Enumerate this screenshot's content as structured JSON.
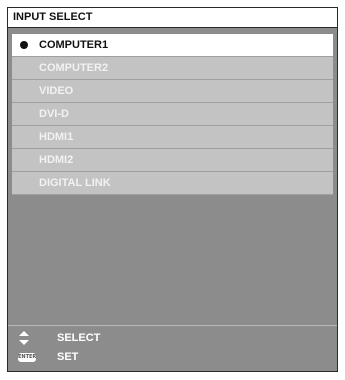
{
  "window": {
    "title": "INPUT SELECT"
  },
  "inputs": [
    {
      "label": "COMPUTER1",
      "selected": true
    },
    {
      "label": "COMPUTER2",
      "selected": false
    },
    {
      "label": "VIDEO",
      "selected": false
    },
    {
      "label": "DVI-D",
      "selected": false
    },
    {
      "label": "HDMI1",
      "selected": false
    },
    {
      "label": "HDMI2",
      "selected": false
    },
    {
      "label": "DIGITAL LINK",
      "selected": false
    }
  ],
  "footer": {
    "select": {
      "icon": "up-down-arrows-icon",
      "label": "SELECT"
    },
    "set": {
      "icon": "enter-button-icon",
      "icon_text": "ENTER",
      "label": "SET"
    }
  },
  "colors": {
    "panel": "#8c8c8c",
    "item": "#c3c3c3",
    "selected": "#ffffff"
  }
}
